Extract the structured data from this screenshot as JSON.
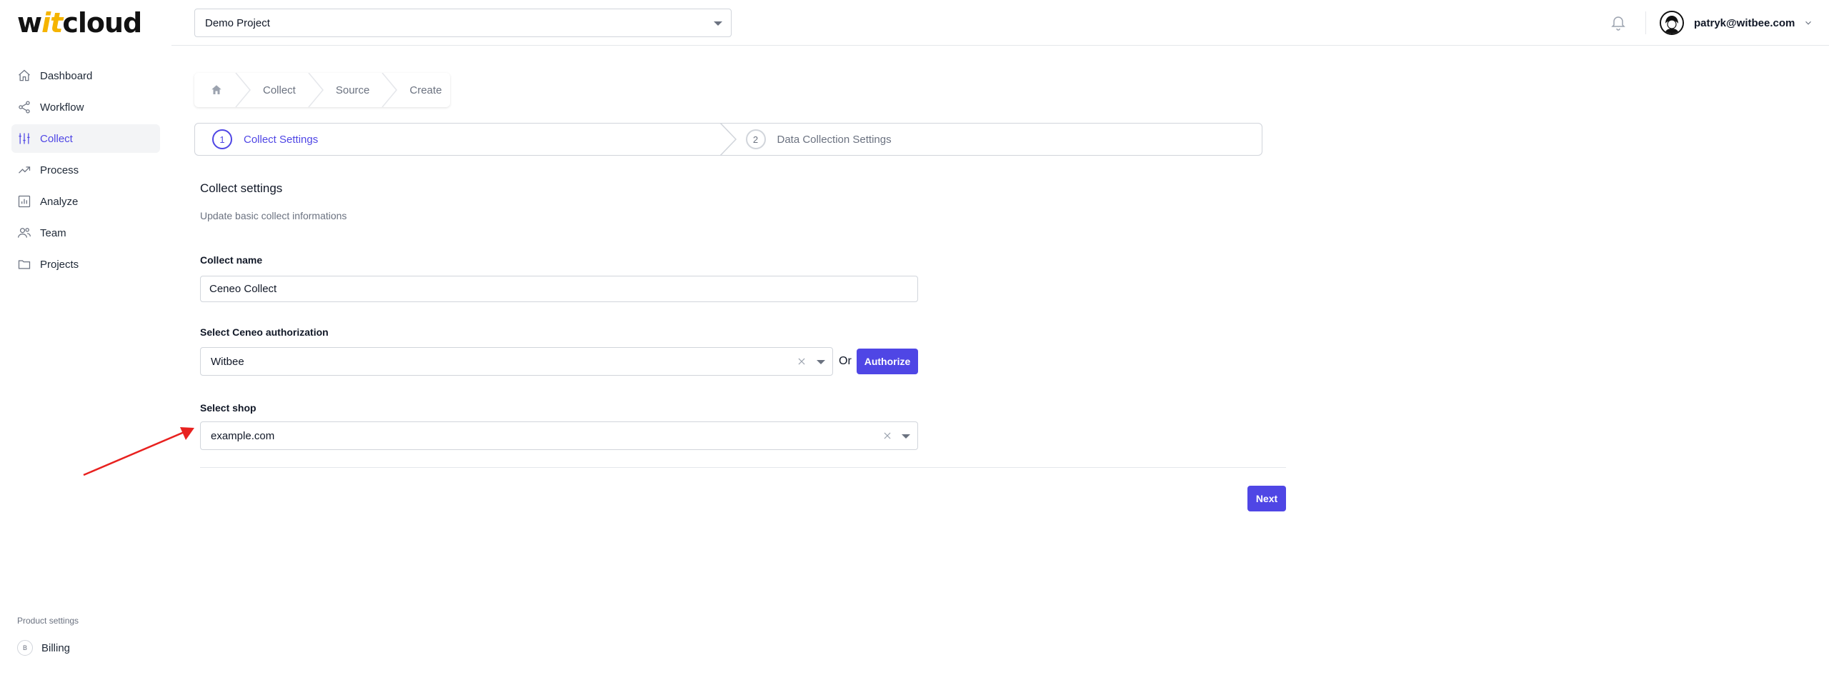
{
  "app": {
    "logo_prefix": "w",
    "logo_accent": "it",
    "logo_suffix": "cloud"
  },
  "sidebar": {
    "items": [
      {
        "label": "Dashboard",
        "icon": "home-icon"
      },
      {
        "label": "Workflow",
        "icon": "share-icon"
      },
      {
        "label": "Collect",
        "icon": "adjustments-icon",
        "active": true
      },
      {
        "label": "Process",
        "icon": "trending-up-icon"
      },
      {
        "label": "Analyze",
        "icon": "chart-icon"
      },
      {
        "label": "Team",
        "icon": "users-icon"
      },
      {
        "label": "Projects",
        "icon": "folder-icon"
      }
    ],
    "product_settings_label": "Product settings",
    "billing": {
      "badge": "B",
      "label": "Billing"
    }
  },
  "topbar": {
    "project": "Demo Project",
    "user_email": "patryk@witbee.com"
  },
  "breadcrumb": [
    "Collect",
    "Source",
    "Create"
  ],
  "steps": [
    {
      "num": "1",
      "label": "Collect Settings",
      "active": true
    },
    {
      "num": "2",
      "label": "Data Collection Settings",
      "active": false
    }
  ],
  "form": {
    "title": "Collect settings",
    "subtitle": "Update basic collect informations",
    "collect_name_label": "Collect name",
    "collect_name_value": "Ceneo Collect",
    "authorization_label": "Select Ceneo authorization",
    "authorization_value": "Witbee",
    "or_text": "Or",
    "authorize_button": "Authorize",
    "shop_label": "Select shop",
    "shop_value": "example.com",
    "next_button": "Next"
  },
  "colors": {
    "accent": "#4f46e5",
    "logo_accent": "#f5b400",
    "annotation": "#e8211f"
  }
}
